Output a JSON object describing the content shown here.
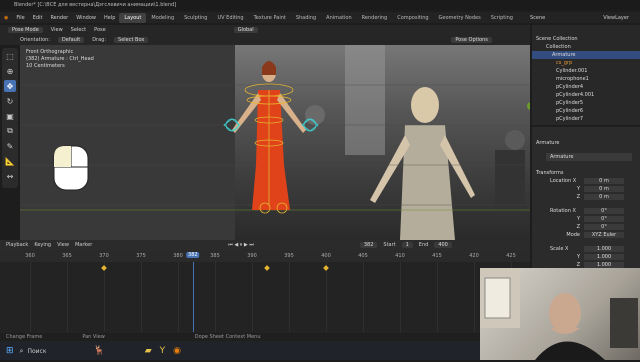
{
  "window_title": "Blender* [C:\\ВСЕ для вестерна\\Дэгслевичи анимации\\1.blend]",
  "menu": [
    "File",
    "Edit",
    "Render",
    "Window",
    "Help"
  ],
  "workspaces": [
    "Layout",
    "Modeling",
    "Sculpting",
    "UV Editing",
    "Texture Paint",
    "Shading",
    "Animation",
    "Rendering",
    "Compositing",
    "Geometry Nodes",
    "Scripting"
  ],
  "active_workspace": "Layout",
  "scene": {
    "label": "Scene",
    "view_layer": "ViewLayer"
  },
  "header": {
    "mode": "Pose Mode",
    "view": "View",
    "select": "Select",
    "pose": "Pose",
    "orientation_label": "Orientation:",
    "orientation": "Default",
    "drag_label": "Drag:",
    "drag": "Select Box",
    "transform": "Global",
    "pose_options": "Pose Options"
  },
  "viewport_info": {
    "line1": "Front Orthographic",
    "line2": "(382) Armature : Ctrl_Head",
    "line3": "10 Centimeters"
  },
  "outliner": {
    "title": "Scene Collection",
    "items": [
      "Collection",
      "Armature",
      "cs_grp",
      "Cylinder.001",
      "microphone1",
      "pCylinder4",
      "pCylinder4.001",
      "pCylinder5",
      "pCylinder6",
      "pCylinder7"
    ]
  },
  "properties": {
    "object": "Armature",
    "data": "Armature",
    "transforms_title": "Transforms",
    "location_label": "Location X",
    "rotation_label": "Rotation X",
    "mode_label": "Mode",
    "scale_label": "Scale X",
    "location": [
      "0 m",
      "0 m",
      "0 m"
    ],
    "rotation": [
      "0°",
      "0°",
      "0°"
    ],
    "mode": "XYZ Euler",
    "scale": [
      "1.000",
      "1.000",
      "1.000"
    ],
    "axes": [
      "X",
      "Y",
      "Z"
    ]
  },
  "timeline": {
    "menu": [
      "Playback",
      "Keying",
      "View",
      "Marker"
    ],
    "current_frame": "382",
    "start_label": "Start",
    "start": "1",
    "end_label": "End",
    "end": "400",
    "ticks": [
      "360",
      "365",
      "370",
      "375",
      "380",
      "385",
      "390",
      "395",
      "400",
      "405",
      "410",
      "415",
      "420",
      "425"
    ],
    "keyframes": [
      "370",
      "392",
      "400"
    ]
  },
  "status": {
    "left": "Change Frame",
    "mid1": "Pan View",
    "mid2": "Dope Sheet Context Menu"
  },
  "taskbar": {
    "search": "Поиск"
  }
}
